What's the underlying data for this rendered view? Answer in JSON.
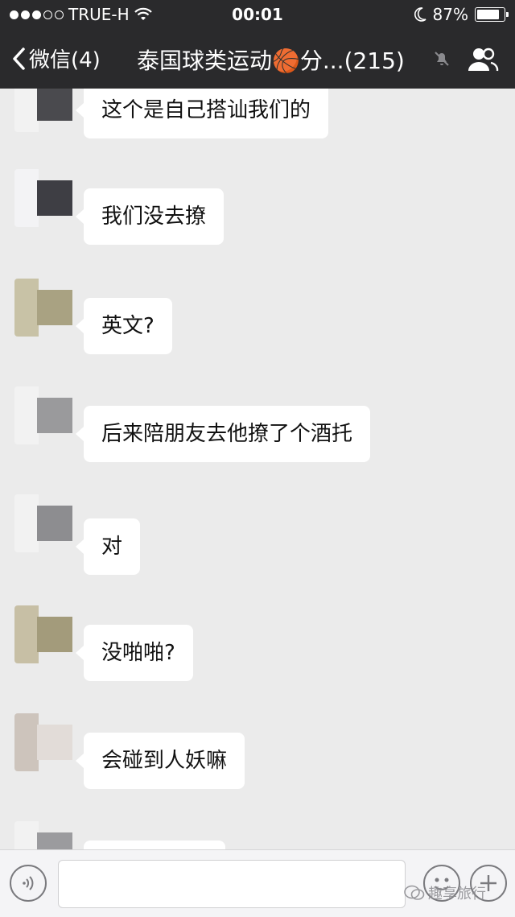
{
  "status_bar": {
    "carrier": "TRUE-H",
    "time": "00:01",
    "battery": "87%",
    "battery_level": 0.87
  },
  "nav": {
    "back_label": "微信(4)",
    "title": "泰国球类运动🏀分...(215)"
  },
  "messages": [
    {
      "text": "这个是自己搭讪我们的",
      "avatar_colors": [
        "#f2f2f2",
        "#4a4a4e"
      ]
    },
    {
      "text": "我们没去撩",
      "avatar_colors": [
        "#f3f3f5",
        "#3e3e44"
      ]
    },
    {
      "text": "英文?",
      "avatar_colors": [
        "#c8c2a6",
        "#a9a282"
      ]
    },
    {
      "text": "后来陪朋友去他撩了个酒托",
      "avatar_colors": [
        "#f2f2f2",
        "#9a9a9c"
      ]
    },
    {
      "text": "对",
      "avatar_colors": [
        "#f2f2f2",
        "#8d8d90"
      ]
    },
    {
      "text": "没啪啪?",
      "avatar_colors": [
        "#c7bfa5",
        "#a39b7b"
      ]
    },
    {
      "text": "会碰到人妖嘛",
      "avatar_colors": [
        "#cdc4bc",
        "#e2dcd8"
      ]
    },
    {
      "text": "",
      "avatar_colors": [
        "#f2f2f2",
        "#9b9b9e"
      ]
    }
  ],
  "watermark": "趣享旅行",
  "icons": {
    "wifi": "wifi-icon",
    "moon": "moon-icon",
    "back": "chevron-left-icon",
    "mute": "bell-muted-icon",
    "group": "group-icon",
    "voice": "voice-icon",
    "emoji": "emoji-icon",
    "plus": "plus-icon"
  }
}
